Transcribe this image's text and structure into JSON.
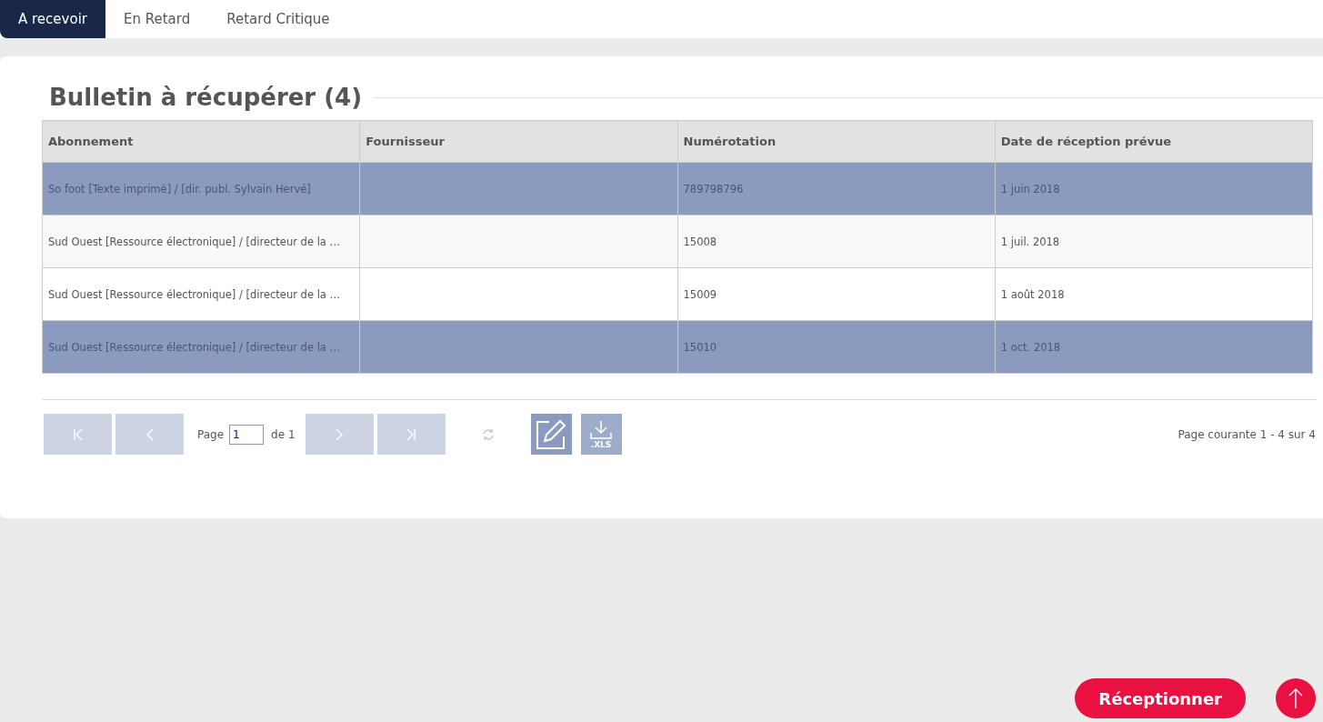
{
  "tabs": [
    {
      "label": "A recevoir",
      "selected": true
    },
    {
      "label": "En Retard",
      "selected": false
    },
    {
      "label": "Retard Critique",
      "selected": false
    }
  ],
  "section": {
    "title": "Bulletin à récupérer (4)"
  },
  "table": {
    "columns": [
      "Abonnement",
      "Fournisseur",
      "Numérotation",
      "Date de réception prévue"
    ],
    "rows": [
      {
        "selected": true,
        "cells": [
          "So foot [Texte imprimé] / [dir. publ. Sylvain Hervé]",
          "",
          "789798796",
          "1 juin 2018"
        ]
      },
      {
        "selected": false,
        "cells": [
          "Sud Ouest [Ressource électronique] / [directeur de la …",
          "",
          "15008",
          "1 juil. 2018"
        ]
      },
      {
        "selected": false,
        "cells": [
          "Sud Ouest [Ressource électronique] / [directeur de la …",
          "",
          "15009",
          "1 août 2018"
        ]
      },
      {
        "selected": true,
        "cells": [
          "Sud Ouest [Ressource électronique] / [directeur de la …",
          "",
          "15010",
          "1 oct. 2018"
        ]
      }
    ]
  },
  "pager": {
    "page_label": "Page",
    "page_value": "1",
    "of_label": "de 1",
    "xls_label": ".XLS",
    "summary": "Page courante 1 - 4 sur 4"
  },
  "actions": {
    "receive": "Réceptionner"
  }
}
